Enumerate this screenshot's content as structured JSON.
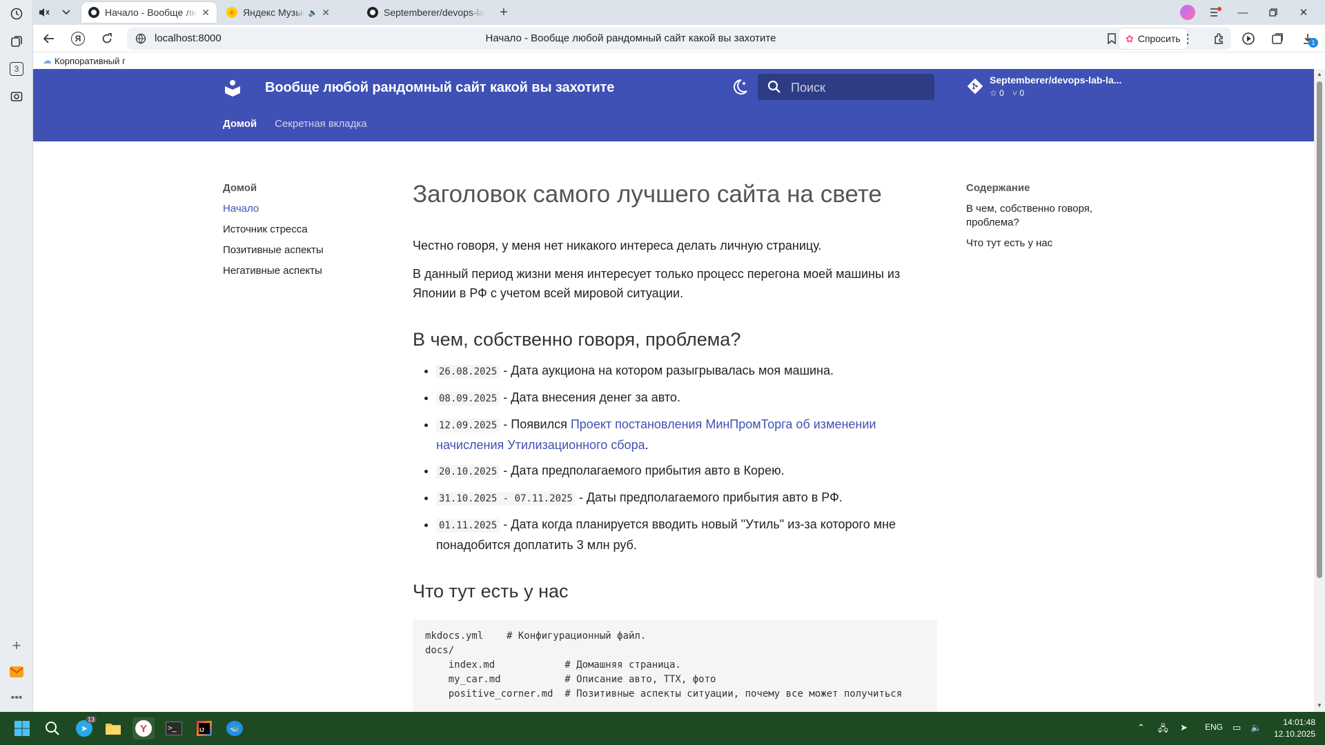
{
  "browser": {
    "tabs": [
      {
        "title": "Начало - Вообще любой рандомный сайт какой вы захотите",
        "active": true
      },
      {
        "title": "Яндекс Музыка — собираем музыку для вас",
        "active": false
      },
      {
        "title": "Septemberer/devops-lab-lab",
        "active": false
      }
    ],
    "address": "localhost:8000",
    "page_title": "Начало - Вообще любой рандомный сайт какой вы захотите",
    "ask_label": "Спросить",
    "bookmark": "Корпоративный г",
    "rail_badge": "3",
    "downloads_badge": "1"
  },
  "site": {
    "title": "Вообще любой рандомный сайт какой вы захотите",
    "search_placeholder": "Поиск",
    "repo_name": "Septemberer/devops-lab-la...",
    "repo_stars": "0",
    "repo_forks": "0",
    "tabs": [
      {
        "label": "Домой",
        "active": true
      },
      {
        "label": "Секретная вкладка",
        "active": false
      }
    ],
    "header_color": "#3f51b5"
  },
  "nav": {
    "heading": "Домой",
    "items": [
      {
        "label": "Начало",
        "active": true
      },
      {
        "label": "Источник стресса",
        "active": false
      },
      {
        "label": "Позитивные аспекты",
        "active": false
      },
      {
        "label": "Негативные аспекты",
        "active": false
      }
    ]
  },
  "toc": {
    "heading": "Содержание",
    "items": [
      "В чем, собственно говоря, проблема?",
      "Что тут есть у нас"
    ]
  },
  "article": {
    "h1": "Заголовок самого лучшего сайта на свете",
    "p1": "Честно говоря, у меня нет никакого интереса делать личную страницу.",
    "p2": "В данный период жизни меня интересует только процесс перегона моей машины из Японии в РФ с учетом всей мировой ситуации.",
    "h2_problem": "В чем, собственно говоря, проблема?",
    "events": [
      {
        "date": "26.08.2025",
        "text": " - Дата аукциона на котором разыгрывалась моя машина."
      },
      {
        "date": "08.09.2025",
        "text": " - Дата внесения денег за авто."
      },
      {
        "date": "12.09.2025",
        "text": " - Появился ",
        "link": "Проект постановления МинПромТорга об изменении начисления Утилизационного сбора",
        "after": "."
      },
      {
        "date": "20.10.2025",
        "text": " - Дата предполагаемого прибытия авто в Корею."
      },
      {
        "date": "31.10.2025 - 07.11.2025",
        "text": " - Даты предполагаемого прибытия авто в РФ."
      },
      {
        "date": "01.11.2025",
        "text": " - Дата когда планируется вводить новый \"Утиль\" из-за которого мне понадобится доплатить 3 млн руб."
      }
    ],
    "h2_have": "Что тут есть у нас",
    "code": "mkdocs.yml    # Конфигурационный файл.\ndocs/\n    index.md            # Домашняя страница.\n    my_car.md           # Описание авто, ТТХ, фото\n    positive_corner.md  # Позитивные аспекты ситуации, почему все может получиться"
  },
  "taskbar": {
    "telegram_badge": "13",
    "lang": "ENG",
    "time": "14:01:48",
    "date": "12.10.2025"
  }
}
